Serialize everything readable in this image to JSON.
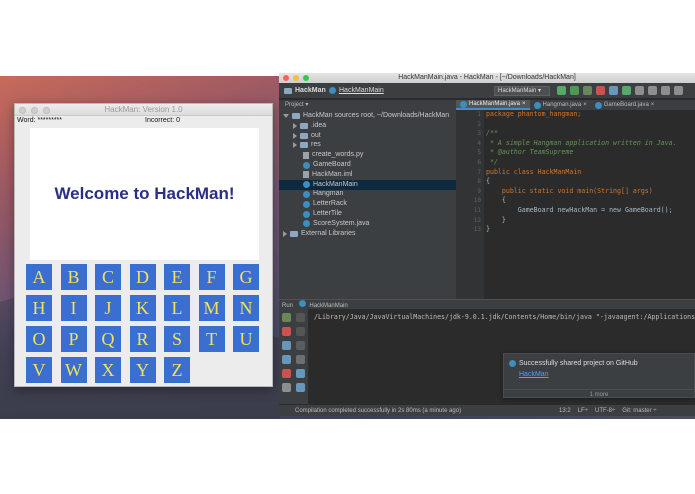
{
  "game_window": {
    "title": "HackMan: Version 1.0",
    "word_label": "Word: *********",
    "incorrect_label": "Incorrect: 0",
    "welcome": "Welcome to HackMan!",
    "letters": [
      "A",
      "B",
      "C",
      "D",
      "E",
      "F",
      "G",
      "H",
      "I",
      "J",
      "K",
      "L",
      "M",
      "N",
      "O",
      "P",
      "Q",
      "R",
      "S",
      "T",
      "U",
      "V",
      "W",
      "X",
      "Y",
      "Z"
    ],
    "tile_color": "#3a6ed0",
    "letter_color": "#f2e25a",
    "title_color": "#2a2f86"
  },
  "ide": {
    "window_title": "HackManMain.java - HackMan - [~/Downloads/HackMan]",
    "breadcrumb": [
      "HackMan",
      "HackManMain"
    ],
    "run_config": "HackManMain",
    "project_label": "Project",
    "tree": [
      {
        "label": "HackMan  sources root, ~/Downloads/HackMan",
        "indent": 0,
        "kind": "folder",
        "arrow": "open"
      },
      {
        "label": ".idea",
        "indent": 1,
        "kind": "folder",
        "arrow": "closed"
      },
      {
        "label": "out",
        "indent": 1,
        "kind": "folder",
        "arrow": "closed"
      },
      {
        "label": "res",
        "indent": 1,
        "kind": "folder",
        "arrow": "closed"
      },
      {
        "label": "create_words.py",
        "indent": 2,
        "kind": "file"
      },
      {
        "label": "GameBoard",
        "indent": 2,
        "kind": "class"
      },
      {
        "label": "HackMan.iml",
        "indent": 2,
        "kind": "file"
      },
      {
        "label": "HackManMain",
        "indent": 2,
        "kind": "class",
        "selected": true
      },
      {
        "label": "Hangman",
        "indent": 2,
        "kind": "class"
      },
      {
        "label": "LetterRack",
        "indent": 2,
        "kind": "class"
      },
      {
        "label": "LetterTile",
        "indent": 2,
        "kind": "class"
      },
      {
        "label": "ScoreSystem.java",
        "indent": 2,
        "kind": "class"
      },
      {
        "label": "External Libraries",
        "indent": 0,
        "kind": "folder",
        "arrow": "closed"
      }
    ],
    "tabs": [
      {
        "label": "HackManMain.java",
        "active": true
      },
      {
        "label": "Hangman.java",
        "active": false
      },
      {
        "label": "GameBoard.java",
        "active": false
      }
    ],
    "line_numbers": [
      "1",
      "2",
      "3",
      "4",
      "5",
      "6",
      "7",
      "8",
      "9",
      "10",
      "11",
      "12",
      "13"
    ],
    "code": [
      "package phantom_hangman;",
      "",
      "/**",
      " * A simple Hangman application written in Java.",
      " * @author TeamSupreme",
      " */",
      "public class HackManMain",
      "{",
      "    public static void main(String[] args)",
      "    {",
      "        GameBoard newHackMan = new GameBoard();",
      "    }",
      "}"
    ],
    "run_label": "Run",
    "run_target": "HackManMain",
    "console_text": "/Library/Java/JavaVirtualMachines/jdk-9.0.1.jdk/Contents/Home/bin/java \"-javaagent:/Applications/Intelli",
    "notification": {
      "title": "Successfully shared project on GitHub",
      "link": "HackMan",
      "more": "1 more"
    },
    "status_message": "Compilation completed successfully in 2s 80ms (a minute ago)",
    "status_right": [
      "13:2",
      "LF÷",
      "UTF-8÷",
      "Git: master ÷"
    ]
  }
}
